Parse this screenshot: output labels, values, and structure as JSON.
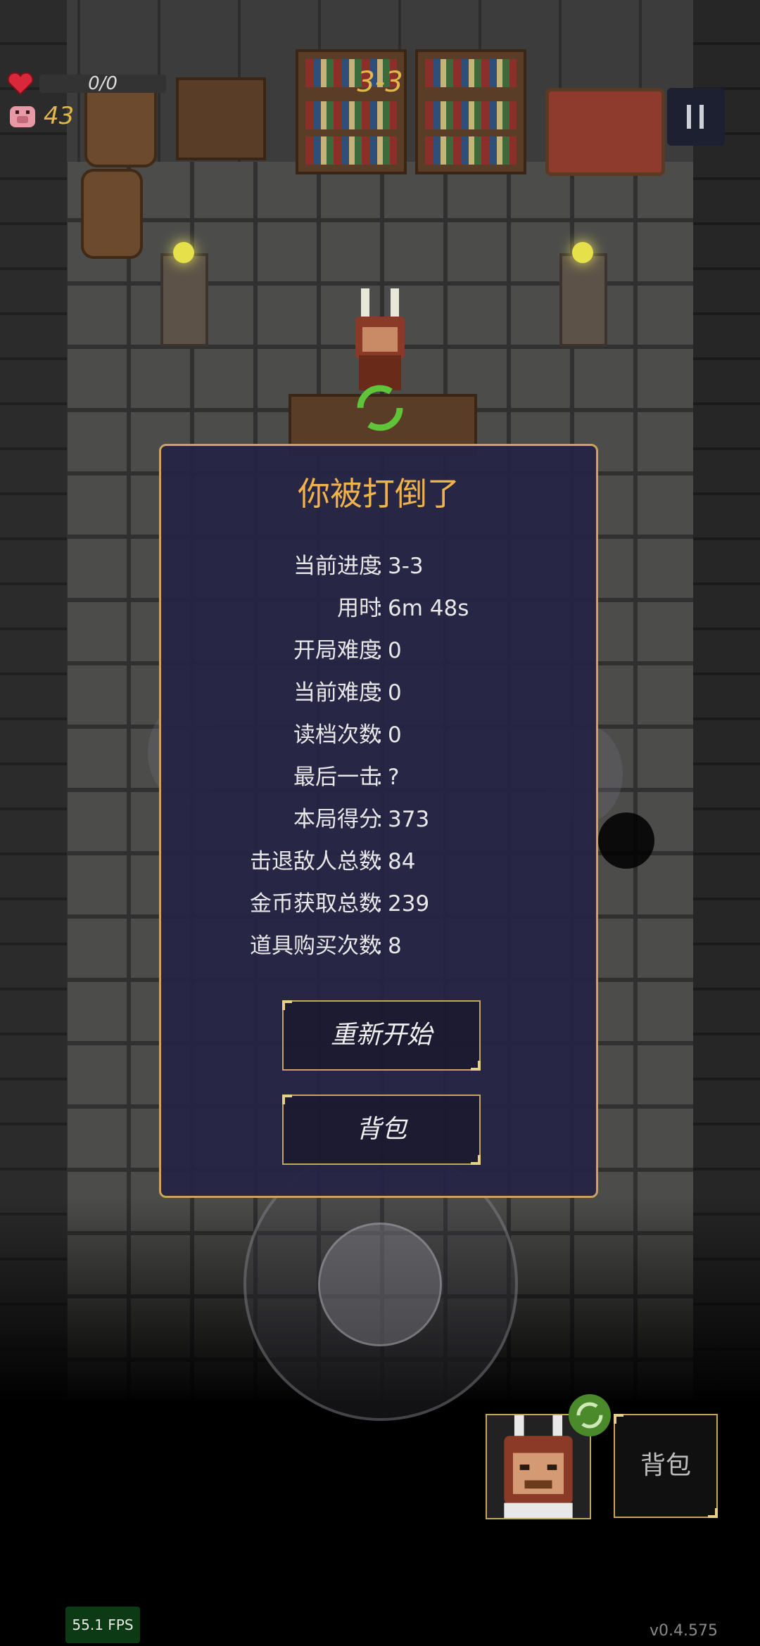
{
  "hud": {
    "hp_text": "0/0",
    "coins": "43",
    "level": "3-3"
  },
  "dialog": {
    "title": "你被打倒了",
    "stats": [
      {
        "label": "当前进度",
        "value": "3-3"
      },
      {
        "label": "用时",
        "value": "6m 48s"
      },
      {
        "label": "开局难度",
        "value": "0"
      },
      {
        "label": "当前难度",
        "value": "0"
      },
      {
        "label": "读档次数",
        "value": "0"
      },
      {
        "label": "最后一击",
        "value": "?"
      },
      {
        "label": "本局得分",
        "value": "373"
      },
      {
        "label": "击退敌人总数",
        "value": "84"
      },
      {
        "label": "金币获取总数",
        "value": "239"
      },
      {
        "label": "道具购买次数",
        "value": "8"
      }
    ],
    "colon": ":",
    "restart_label": "重新开始",
    "backpack_label": "背包"
  },
  "bottom": {
    "backpack_label": "背包"
  },
  "fps": "55.1 FPS",
  "version": "v0.4.575",
  "colors": {
    "accent_gold": "#c9a45c",
    "title_orange": "#f0b24a",
    "dialog_bg": "#26244a"
  }
}
